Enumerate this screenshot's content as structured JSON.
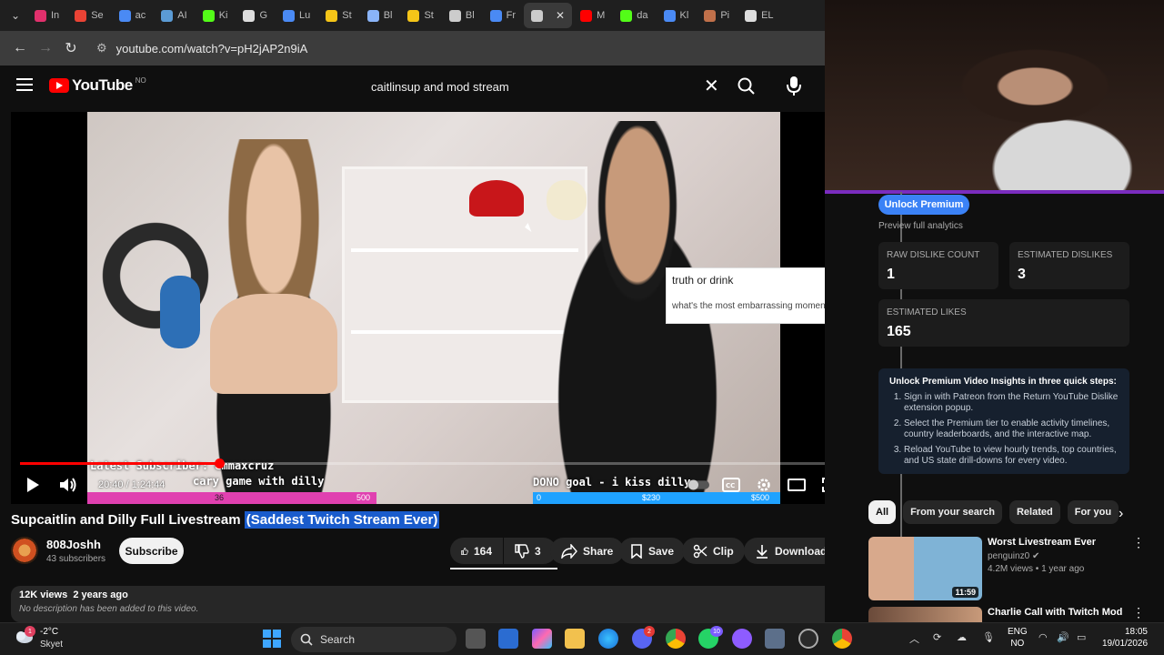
{
  "browser": {
    "tabs": [
      {
        "label": "In",
        "color": "#e1306c"
      },
      {
        "label": "Se",
        "color": "#ea4335"
      },
      {
        "label": "ac",
        "color": "#4a8af4"
      },
      {
        "label": "AI",
        "color": "#5b9bd5"
      },
      {
        "label": "Ki",
        "color": "#53fc18"
      },
      {
        "label": "G",
        "color": "#dddddd"
      },
      {
        "label": "Lu",
        "color": "#4a8af4"
      },
      {
        "label": "St",
        "color": "#f5c518"
      },
      {
        "label": "Bl",
        "color": "#8ab4f8"
      },
      {
        "label": "St",
        "color": "#f5c518"
      },
      {
        "label": "Bl",
        "color": "#cccccc"
      },
      {
        "label": "Fr",
        "color": "#4a8af4"
      },
      {
        "label": "",
        "color": "#cccccc"
      },
      {
        "label": "M",
        "color": "#ff0000"
      },
      {
        "label": "da",
        "color": "#53fc18"
      },
      {
        "label": "Kl",
        "color": "#4a8af4"
      },
      {
        "label": "Pi",
        "color": "#c0704a"
      },
      {
        "label": "EL",
        "color": "#dddddd"
      }
    ],
    "active_tab_index": 12,
    "url": "youtube.com/watch?v=pH2jAP2n9iA"
  },
  "youtube": {
    "logo_text": "YouTube",
    "region": "NO",
    "search_query": "caitlinsup and mod stream"
  },
  "player": {
    "overlay_subscriber": "Latest Subscriber: emmaxcruz",
    "overlay_game": "cary game with dilly",
    "sub_bar": {
      "current": "36",
      "goal": "500"
    },
    "overlay_dono": "DONO goal - i kiss dilly",
    "dono_bar": {
      "start": "0",
      "current": "$230",
      "goal": "$500"
    },
    "card_title": "truth or drink",
    "card_text": "what's the most embarrassing moment of",
    "time_current": "20:40",
    "time_total": "1:24:44",
    "progress_fraction": 0.241
  },
  "video": {
    "title": "Supcaitlin and Dilly Full Livestream",
    "title_highlight": "(Saddest Twitch Stream Ever)",
    "channel": "808Joshh",
    "subscribers": "43 subscribers",
    "subscribe_label": "Subscribe",
    "likes": "164",
    "dislikes": "3",
    "share_label": "Share",
    "save_label": "Save",
    "clip_label": "Clip",
    "download_label": "Download",
    "views": "12K views",
    "age": "2 years ago",
    "description": "No description has been added to this video."
  },
  "dislike_panel": {
    "premium_button": "Unlock Premium",
    "preview_text": "Preview full analytics",
    "raw_dislike_label": "RAW DISLIKE COUNT",
    "raw_dislike_value": "1",
    "est_dislikes_label": "ESTIMATED DISLIKES",
    "est_dislikes_value": "3",
    "est_likes_label": "ESTIMATED LIKES",
    "est_likes_value": "165",
    "insights_heading": "Unlock Premium Video Insights in three quick steps:",
    "steps": [
      "Sign in with Patreon from the Return YouTube Dislike extension popup.",
      "Select the Premium tier to enable activity timelines, country leaderboards, and the interactive map.",
      "Reload YouTube to view hourly trends, top countries, and US state drill-downs for every video."
    ]
  },
  "chips": [
    "All",
    "From your search",
    "Related",
    "For you"
  ],
  "recommendations": [
    {
      "title": "Worst Livestream Ever",
      "channel": "penguinz0",
      "meta": "4.2M views • 1 year ago",
      "duration": "11:59"
    },
    {
      "title": "Charlie Call with Twitch Mod",
      "channel": "",
      "meta": "",
      "duration": ""
    }
  ],
  "taskbar": {
    "temperature": "-2°C",
    "weather": "Skyet",
    "weather_badge": "1",
    "search_label": "Search",
    "discord_badge": "2",
    "whatsapp_badge": "10",
    "lang_top": "ENG",
    "lang_bottom": "NO",
    "time": "18:05",
    "date": "19/01/2026"
  }
}
